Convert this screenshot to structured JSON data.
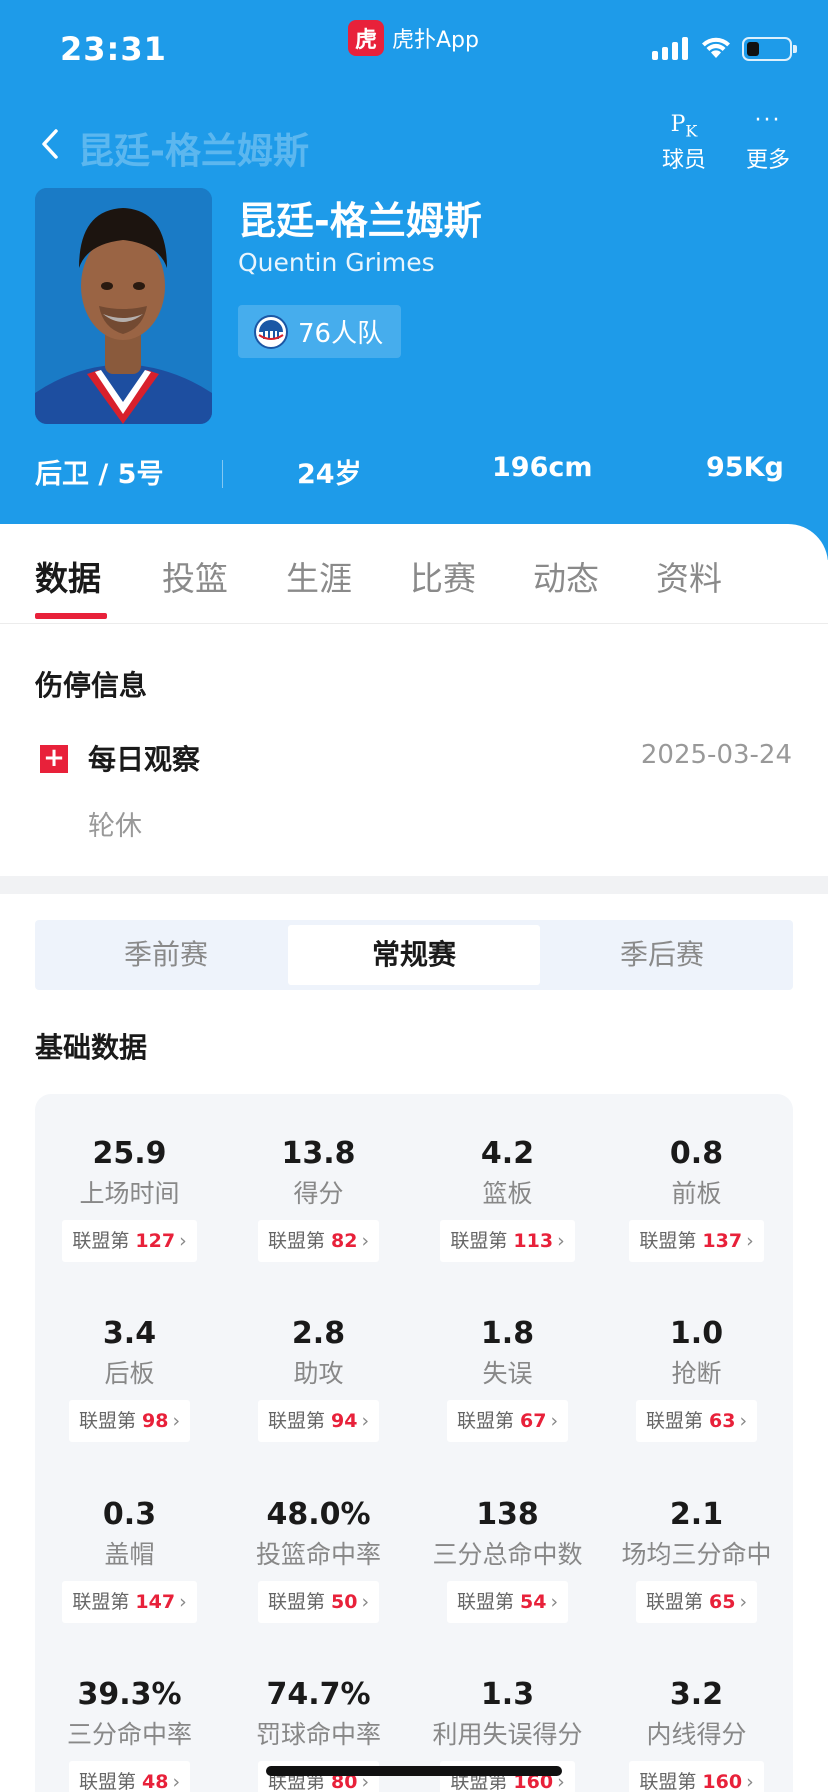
{
  "status_bar": {
    "time": "23:31",
    "app_logo_text": "虎",
    "app_name": "虎扑App"
  },
  "nav": {
    "title": "昆廷-格兰姆斯",
    "pk_icon_text": "P",
    "pk_icon_sub": "K",
    "pk_label": "球员",
    "more_icon": "···",
    "more_label": "更多"
  },
  "player": {
    "name_cn": "昆廷-格兰姆斯",
    "name_en": "Quentin Grimes",
    "team": "76人队",
    "position_number": "后卫 / 5号",
    "age": "24岁",
    "height": "196cm",
    "weight": "95Kg"
  },
  "tabs": [
    "数据",
    "投篮",
    "生涯",
    "比赛",
    "动态",
    "资料"
  ],
  "injury": {
    "section_title": "伤停信息",
    "icon_glyph": "+",
    "name": "每日观察",
    "date": "2025-03-24",
    "status": "轮休"
  },
  "season_switch": [
    "季前赛",
    "常规赛",
    "季后赛"
  ],
  "basic_stats_title": "基础数据",
  "rank_prefix": "联盟第",
  "chevron": "›",
  "stats": [
    {
      "value": "25.9",
      "label": "上场时间",
      "rank": "127"
    },
    {
      "value": "13.8",
      "label": "得分",
      "rank": "82"
    },
    {
      "value": "4.2",
      "label": "篮板",
      "rank": "113"
    },
    {
      "value": "0.8",
      "label": "前板",
      "rank": "137"
    },
    {
      "value": "3.4",
      "label": "后板",
      "rank": "98"
    },
    {
      "value": "2.8",
      "label": "助攻",
      "rank": "94"
    },
    {
      "value": "1.8",
      "label": "失误",
      "rank": "67"
    },
    {
      "value": "1.0",
      "label": "抢断",
      "rank": "63"
    },
    {
      "value": "0.3",
      "label": "盖帽",
      "rank": "147"
    },
    {
      "value": "48.0%",
      "label": "投篮命中率",
      "rank": "50"
    },
    {
      "value": "138",
      "label": "三分总命中数",
      "rank": "54"
    },
    {
      "value": "2.1",
      "label": "场均三分命中",
      "rank": "65"
    },
    {
      "value": "39.3%",
      "label": "三分命中率",
      "rank": "48"
    },
    {
      "value": "74.7%",
      "label": "罚球命中率",
      "rank": "80"
    },
    {
      "value": "1.3",
      "label": "利用失误得分",
      "rank": "160"
    },
    {
      "value": "3.2",
      "label": "内线得分",
      "rank": "160"
    }
  ],
  "colors": {
    "header_blue": "#1e9be9",
    "accent_red": "#e8213a",
    "panel_bg": "#f4f6f9"
  }
}
